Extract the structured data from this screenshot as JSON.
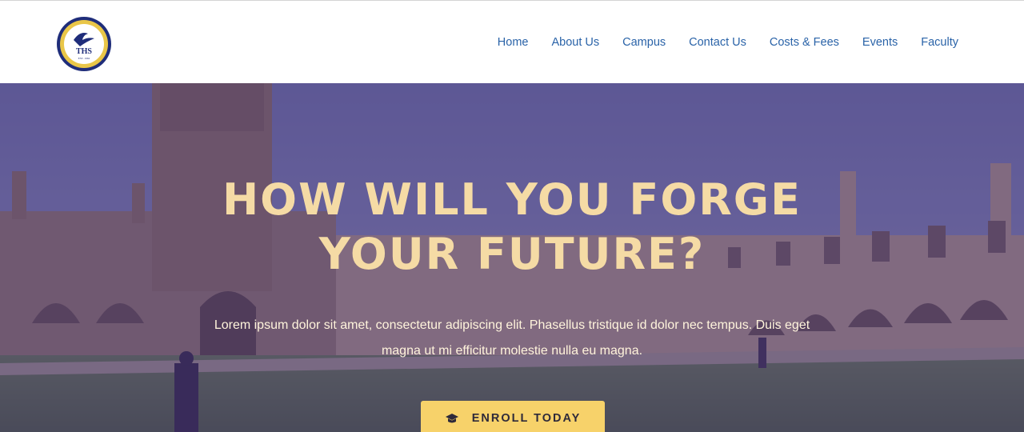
{
  "logo": {
    "initials": "THS",
    "ring_text": "THANET HALL SCHOOL",
    "motto": "Pursuit for Knowledge",
    "year": "EST. 1962"
  },
  "nav": {
    "items": [
      {
        "label": "Home"
      },
      {
        "label": "About Us"
      },
      {
        "label": "Campus"
      },
      {
        "label": "Contact Us"
      },
      {
        "label": "Costs & Fees"
      },
      {
        "label": "Events"
      },
      {
        "label": "Faculty"
      }
    ]
  },
  "hero": {
    "headline_line1": "HOW WILL YOU FORGE",
    "headline_line2": "YOUR FUTURE?",
    "subtext": "Lorem ipsum dolor sit amet, consectetur adipiscing elit. Phasellus tristique id dolor nec tempus. Duis eget magna ut mi efficitur molestie nulla eu magna.",
    "cta_label": "ENROLL TODAY",
    "cta_icon": "graduation-cap-icon"
  },
  "colors": {
    "nav_link": "#2a63a8",
    "overlay": "#46327a",
    "headline": "#f5dba5",
    "cta_bg": "#f7d26a"
  }
}
